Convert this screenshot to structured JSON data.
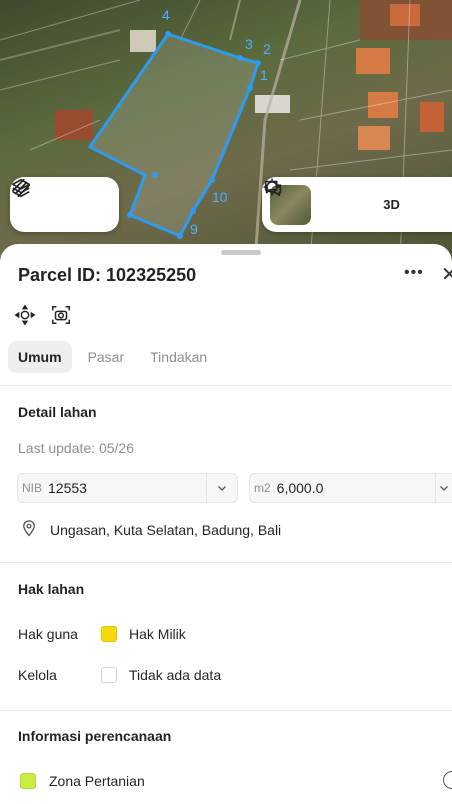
{
  "map": {
    "vertex_labels": [
      "1",
      "2",
      "3",
      "4",
      "9",
      "10"
    ],
    "left_toolbar": {
      "layers_icon": "layers-icon",
      "draw_icon": "draw-icon"
    },
    "right_toolbar": {
      "satellite_thumb": "satellite-thumbnail",
      "locate_icon": "crosshair-icon",
      "three_d_label": "3D",
      "chat_icon": "chat-icon"
    }
  },
  "panel": {
    "title": "Parcel ID: 102325250",
    "more_icon": "more-icon",
    "close_icon": "close-icon",
    "zoom_icon": "zoom-to-parcel-icon",
    "camera_icon": "camera-icon",
    "tabs": [
      {
        "label": "Umum",
        "active": true
      },
      {
        "label": "Pasar",
        "active": false
      },
      {
        "label": "Tindakan",
        "active": false
      }
    ]
  },
  "detail": {
    "title": "Detail lahan",
    "last_update": "Last update: 05/26",
    "nib_prefix": "NIB",
    "nib_value": "12553",
    "area_prefix": "m2",
    "area_value": "6,000.0",
    "location": "Ungasan, Kuta Selatan, Badung, Bali"
  },
  "hak": {
    "title": "Hak lahan",
    "rows": [
      {
        "label": "Hak guna",
        "value": "Hak Milik",
        "color": "#f5d90a"
      },
      {
        "label": "Kelola",
        "value": "Tidak ada data",
        "color": "#ffffff"
      }
    ]
  },
  "planning": {
    "title": "Informasi perencanaan",
    "zone": "Zona Pertanian",
    "zone_color": "#c8ee44"
  }
}
